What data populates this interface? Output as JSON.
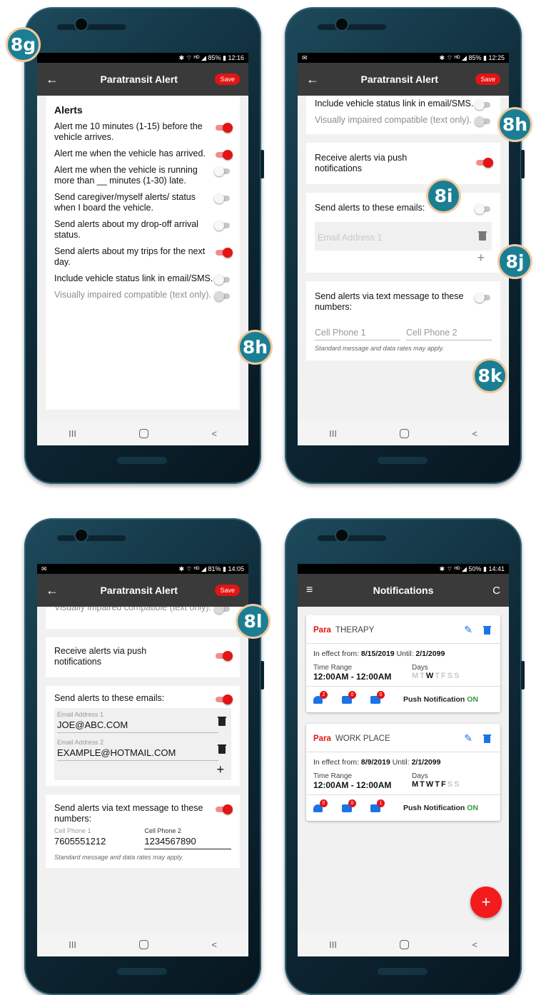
{
  "phone1": {
    "status": {
      "icons": "✱ ⌔ ᴴᴰ ◢",
      "battery": "85%",
      "time": "12:16"
    },
    "appbar": {
      "title": "Paratransit Alert",
      "save": "Save"
    },
    "section_title": "Alerts",
    "alerts": [
      {
        "label": "Alert me 10 minutes (1-15) before the vehicle arrives.",
        "on": true
      },
      {
        "label": "Alert me when the vehicle has arrived.",
        "on": true
      },
      {
        "label": "Alert me when the vehicle is running more than __ minutes (1-30) late.",
        "on": false
      },
      {
        "label": "Send caregiver/myself alerts/ status when I board the vehicle.",
        "on": false
      },
      {
        "label": "Send alerts about my drop-off arrival status.",
        "on": false
      },
      {
        "label": "Send alerts about my trips for the next day.",
        "on": true
      },
      {
        "label": "Include vehicle status link in email/SMS.",
        "on": false
      },
      {
        "label": "Visually impaired compatible (text only).",
        "on": false,
        "dim": true
      }
    ],
    "badges": {
      "a": "8g",
      "b": "8h"
    }
  },
  "phone2": {
    "status": {
      "left": "✉",
      "icons": "✱ ⌔ ᴴᴰ ◢",
      "battery": "85%",
      "time": "12:25"
    },
    "appbar": {
      "title": "Paratransit Alert",
      "save": "Save"
    },
    "link_label": "Include vehicle status link in email/SMS.",
    "visual_label": "Visually impaired compatible (text only).",
    "push_label": "Receive alerts via push notifications",
    "emails_label": "Send alerts to these emails:",
    "email_placeholder": "Email Address 1",
    "add": "+",
    "sms_label": "Send alerts via text message to these numbers:",
    "phone1_placeholder": "Cell Phone 1",
    "phone2_placeholder": "Cell Phone 2",
    "note": "Standard message and data rates may apply.",
    "badges": {
      "h": "8h",
      "i": "8i",
      "j": "8j",
      "k": "8k"
    }
  },
  "phone3": {
    "status": {
      "left": "✉",
      "icons": "✱ ⌔ ᴴᴰ ◢",
      "battery": "81%",
      "time": "14:05"
    },
    "appbar": {
      "title": "Paratransit Alert",
      "save": "Save"
    },
    "visual_label": "Visually impaired compatible (text only).",
    "push_label": "Receive alerts via push notifications",
    "emails_label": "Send alerts to these emails:",
    "email1_label": "Email Address 1",
    "email1_value": "JOE@ABC.COM",
    "email2_label": "Email Address 2",
    "email2_value": "EXAMPLE@HOTMAIL.COM",
    "add": "+",
    "sms_label": "Send alerts via text message to these numbers:",
    "cell1_label": "Cell Phone 1",
    "cell1_value": "7605551212",
    "cell2_label": "Cell Phone 2",
    "cell2_value": "1234567890",
    "note": "Standard message and data rates may apply.",
    "badge": "8l"
  },
  "phone4": {
    "status": {
      "icons": "✱ ⌔ ᴴᴰ ◢",
      "battery": "50%",
      "time": "14:41"
    },
    "appbar": {
      "title": "Notifications",
      "refresh": "C"
    },
    "cards": [
      {
        "tag": "Para",
        "name": "THERAPY",
        "effect_prefix": "In effect from:",
        "from": "8/15/2019",
        "until_prefix": "Until:",
        "until": "2/1/2099",
        "time_range_label": "Time Range",
        "time_range": "12:00AM - 12:00AM",
        "days_label": "Days",
        "days": [
          {
            "d": "M",
            "a": false
          },
          {
            "d": "T",
            "a": false
          },
          {
            "d": "W",
            "a": true
          },
          {
            "d": "T",
            "a": false
          },
          {
            "d": "F",
            "a": false
          },
          {
            "d": "S",
            "a": false
          },
          {
            "d": "S",
            "a": false
          }
        ],
        "counts": [
          "2",
          "0",
          "0"
        ],
        "push_text": "Push Notification",
        "push_state": "ON"
      },
      {
        "tag": "Para",
        "name": "WORK PLACE",
        "effect_prefix": "In effect from:",
        "from": "8/9/2019",
        "until_prefix": "Until:",
        "until": "2/1/2099",
        "time_range_label": "Time Range",
        "time_range": "12:00AM - 12:00AM",
        "days_label": "Days",
        "days": [
          {
            "d": "M",
            "a": true
          },
          {
            "d": "T",
            "a": true
          },
          {
            "d": "W",
            "a": true
          },
          {
            "d": "T",
            "a": true
          },
          {
            "d": "F",
            "a": true
          },
          {
            "d": "S",
            "a": false
          },
          {
            "d": "S",
            "a": false
          }
        ],
        "counts": [
          "0",
          "0",
          "1"
        ],
        "push_text": "Push Notification",
        "push_state": "ON"
      }
    ],
    "fab": "+"
  },
  "nav": {
    "recent": "III",
    "back": "<"
  },
  "colors": {
    "accent_red": "#e31414",
    "appbar": "#3a3a3a",
    "link_blue": "#1a73e8",
    "badge_teal": "#1b7f94",
    "on_green": "#2e9c3f"
  }
}
